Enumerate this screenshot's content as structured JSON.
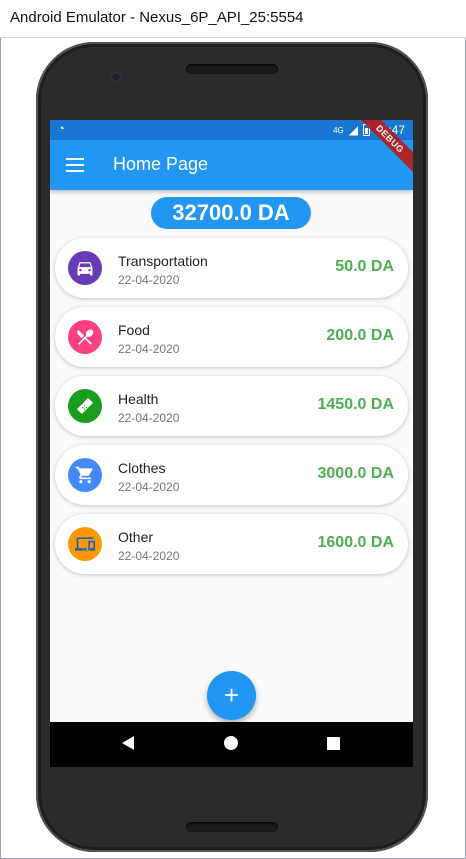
{
  "window": {
    "title": "Android Emulator - Nexus_6P_API_25:5554"
  },
  "status_bar": {
    "time": "10:47",
    "network": "4G"
  },
  "debug_banner": "DEBUG",
  "app_bar": {
    "title": "Home Page",
    "menu_icon": "menu-icon"
  },
  "total": "32700.0 DA",
  "expenses": [
    {
      "category": "Transportation",
      "date": "22-04-2020",
      "amount": "50.0 DA",
      "icon": "car-icon",
      "color": "#673ab7"
    },
    {
      "category": "Food",
      "date": "22-04-2020",
      "amount": "200.0 DA",
      "icon": "utensils-icon",
      "color": "#ff4081"
    },
    {
      "category": "Health",
      "date": "22-04-2020",
      "amount": "1450.0 DA",
      "icon": "bandage-icon",
      "color": "#1b9c1f"
    },
    {
      "category": "Clothes",
      "date": "22-04-2020",
      "amount": "3000.0 DA",
      "icon": "cart-icon",
      "color": "#448aff"
    },
    {
      "category": "Other",
      "date": "22-04-2020",
      "amount": "1600.0 DA",
      "icon": "devices-icon",
      "color": "#ff9800"
    }
  ],
  "fab": {
    "label": "+"
  },
  "colors": {
    "primary": "#2196f3",
    "primary_dark": "#1976d2",
    "amount": "#4caf50"
  }
}
